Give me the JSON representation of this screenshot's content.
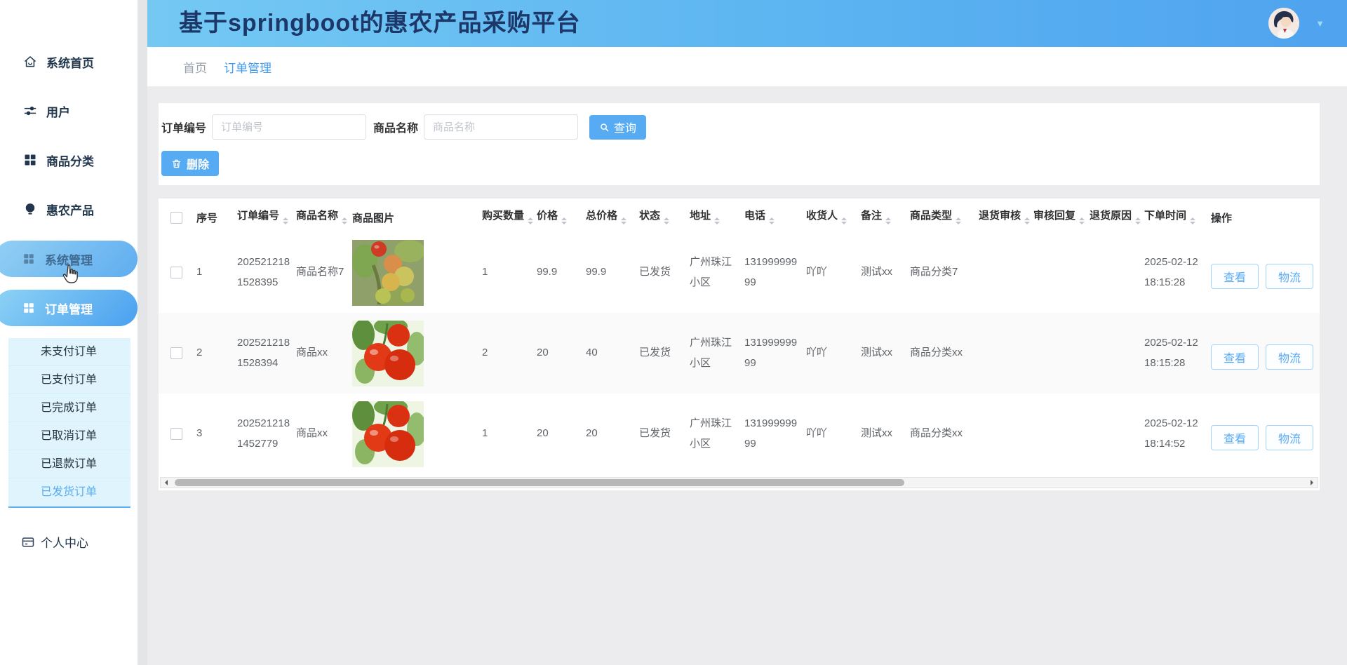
{
  "app": {
    "title": "基于springboot的惠农产品采购平台"
  },
  "header": {
    "caret": "▼",
    "avatar_icon": "user-avatar"
  },
  "breadcrumb": {
    "items": [
      {
        "label": "首页",
        "active": false
      },
      {
        "label": "订单管理",
        "active": true
      }
    ]
  },
  "sidebar": {
    "items": [
      {
        "label": "系统首页",
        "icon": "home-icon",
        "state": "normal"
      },
      {
        "label": "用户",
        "icon": "sliders-icon",
        "state": "normal"
      },
      {
        "label": "商品分类",
        "icon": "grid-icon",
        "state": "normal"
      },
      {
        "label": "惠农产品",
        "icon": "bulb-icon",
        "state": "normal"
      },
      {
        "label": "系统管理",
        "icon": "grid-icon",
        "state": "hover"
      },
      {
        "label": "订单管理",
        "icon": "grid-icon",
        "state": "active"
      }
    ],
    "submenu": {
      "items": [
        {
          "label": "未支付订单",
          "active": false
        },
        {
          "label": "已支付订单",
          "active": false
        },
        {
          "label": "已完成订单",
          "active": false
        },
        {
          "label": "已取消订单",
          "active": false
        },
        {
          "label": "已退款订单",
          "active": false
        },
        {
          "label": "已发货订单",
          "active": true
        }
      ]
    },
    "profile": {
      "label": "个人中心",
      "icon": "card-icon"
    }
  },
  "toolbar": {
    "order_no": {
      "label": "订单编号",
      "placeholder": "订单编号",
      "value": ""
    },
    "product_name": {
      "label": "商品名称",
      "placeholder": "商品名称",
      "value": ""
    },
    "query_label": "查询",
    "query_icon": "search-icon",
    "delete_label": "删除",
    "delete_icon": "trash-icon"
  },
  "table": {
    "columns": [
      {
        "label": "",
        "key": "checkbox",
        "sortable": false
      },
      {
        "label": "序号",
        "key": "index",
        "sortable": false
      },
      {
        "label": "订单编号",
        "key": "orderNo",
        "sortable": true
      },
      {
        "label": "商品名称",
        "key": "productName",
        "sortable": true
      },
      {
        "label": "商品图片",
        "key": "productImage",
        "sortable": false
      },
      {
        "label": "购买数量",
        "key": "quantity",
        "sortable": true
      },
      {
        "label": "价格",
        "key": "price",
        "sortable": true
      },
      {
        "label": "总价格",
        "key": "totalPrice",
        "sortable": true
      },
      {
        "label": "状态",
        "key": "status",
        "sortable": true
      },
      {
        "label": "地址",
        "key": "address",
        "sortable": true
      },
      {
        "label": "电话",
        "key": "phone",
        "sortable": true
      },
      {
        "label": "收货人",
        "key": "consignee",
        "sortable": true
      },
      {
        "label": "备注",
        "key": "remark",
        "sortable": true
      },
      {
        "label": "商品类型",
        "key": "productType",
        "sortable": true
      },
      {
        "label": "退货审核",
        "key": "returnAudit",
        "sortable": true
      },
      {
        "label": "审核回复",
        "key": "auditReply",
        "sortable": true
      },
      {
        "label": "退货原因",
        "key": "returnReason",
        "sortable": true
      },
      {
        "label": "下单时间",
        "key": "orderTime",
        "sortable": true
      },
      {
        "label": "操作",
        "key": "actions",
        "sortable": false
      }
    ],
    "rows": [
      {
        "index": "1",
        "orderNo": "2025212181528395",
        "productName": "商品名称7",
        "image": "fruit",
        "quantity": "1",
        "price": "99.9",
        "totalPrice": "99.9",
        "status": "已发货",
        "address": "广州珠江小区",
        "phone": "13199999999",
        "consignee": "吖吖",
        "remark": "测试xx",
        "productType": "商品分类7",
        "returnAudit": "",
        "auditReply": "",
        "returnReason": "",
        "orderTime": "2025-02-12 18:15:28"
      },
      {
        "index": "2",
        "orderNo": "2025212181528394",
        "productName": "商品xx",
        "image": "tomato",
        "quantity": "2",
        "price": "20",
        "totalPrice": "40",
        "status": "已发货",
        "address": "广州珠江小区",
        "phone": "13199999999",
        "consignee": "吖吖",
        "remark": "测试xx",
        "productType": "商品分类xx",
        "returnAudit": "",
        "auditReply": "",
        "returnReason": "",
        "orderTime": "2025-02-12 18:15:28"
      },
      {
        "index": "3",
        "orderNo": "2025212181452779",
        "productName": "商品xx",
        "image": "tomato",
        "quantity": "1",
        "price": "20",
        "totalPrice": "20",
        "status": "已发货",
        "address": "广州珠江小区",
        "phone": "13199999999",
        "consignee": "吖吖",
        "remark": "测试xx",
        "productType": "商品分类xx",
        "returnAudit": "",
        "auditReply": "",
        "returnReason": "",
        "orderTime": "2025-02-12 18:14:52"
      }
    ],
    "row_actions": [
      "查看",
      "物流"
    ]
  },
  "colors": {
    "header_gradient_start": "#74c9f3",
    "header_gradient_end": "#4fa3ef",
    "accent_blue": "#57abf3",
    "active_link": "#58aef5",
    "title_color": "#1c3768",
    "submenu_bg": "#e0f4fd",
    "stripe_bg": "#fafafa"
  }
}
